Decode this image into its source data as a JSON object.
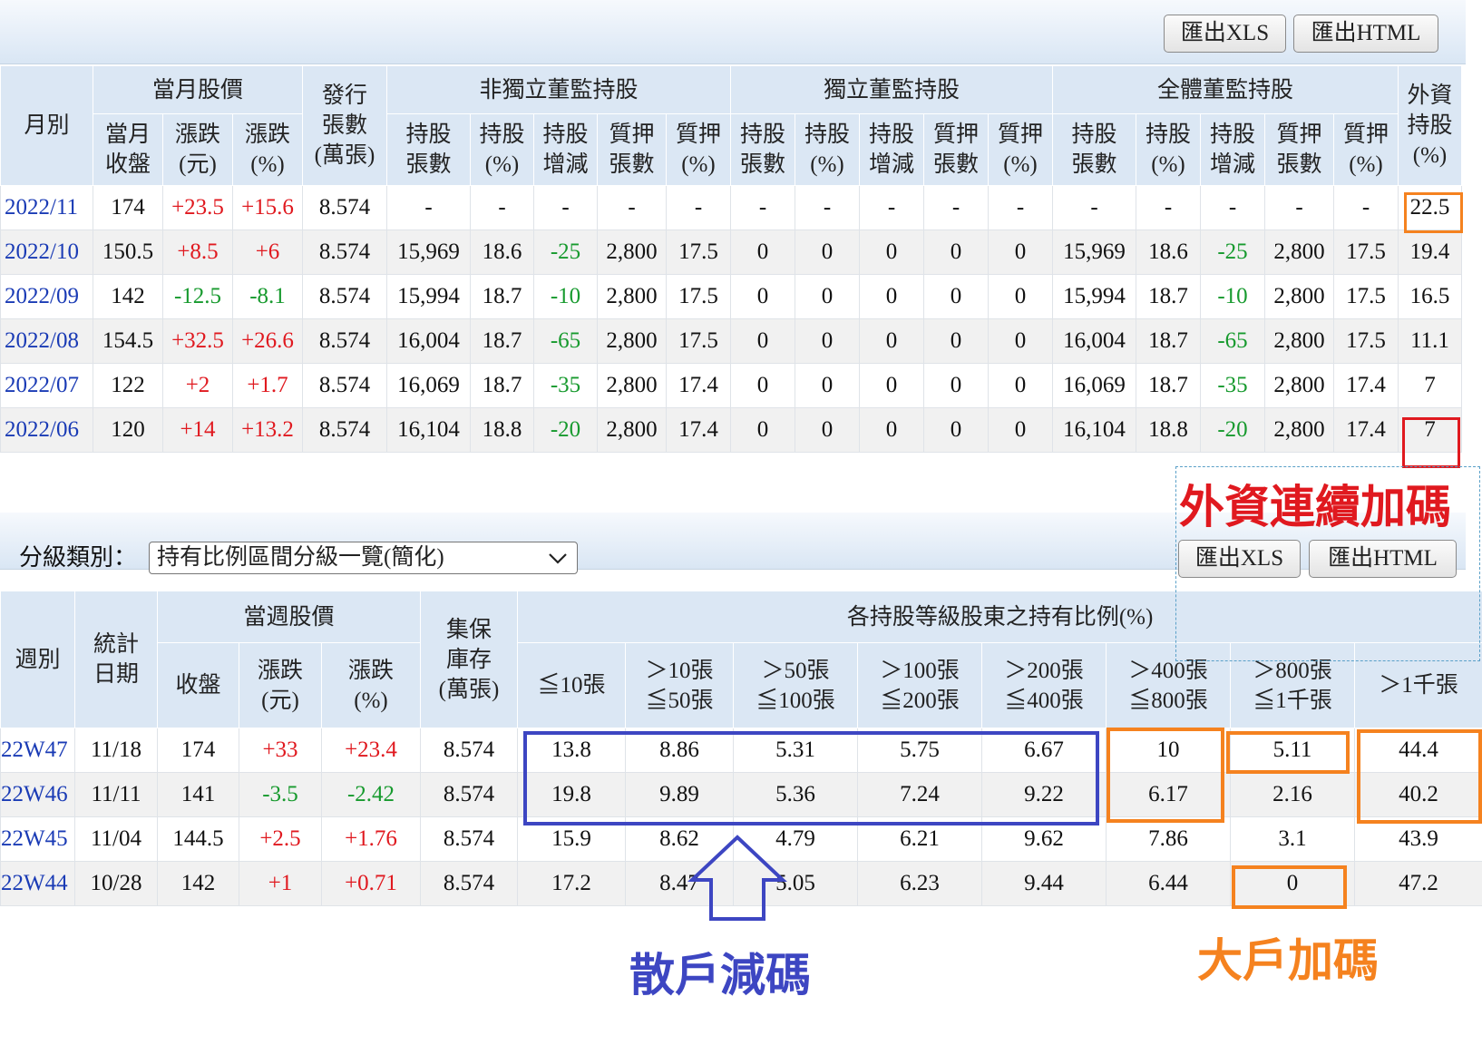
{
  "buttons": {
    "xls": "匯出XLS",
    "html": "匯出HTML"
  },
  "table1": {
    "month_col": "月別",
    "group_price": "當月股價",
    "issued": "發行\n張數\n(萬張)",
    "group_nonind": "非獨立董監持股",
    "group_ind": "獨立董監持股",
    "group_all": "全體董監持股",
    "foreign": "外資\n持股\n(%)",
    "price_cols": [
      "當月\n收盤",
      "漲跌\n(元)",
      "漲跌\n(%)"
    ],
    "hold_cols": [
      "持股\n張數",
      "持股\n(%)",
      "持股\n增減",
      "質押\n張數",
      "質押\n(%)"
    ],
    "rows": [
      [
        "2022/11",
        "174",
        "+23.5",
        "+15.6",
        "8.574",
        "-",
        "-",
        "-",
        "-",
        "-",
        "-",
        "-",
        "-",
        "-",
        "-",
        "-",
        "-",
        "-",
        "-",
        "-",
        "22.5"
      ],
      [
        "2022/10",
        "150.5",
        "+8.5",
        "+6",
        "8.574",
        "15,969",
        "18.6",
        "-25",
        "2,800",
        "17.5",
        "0",
        "0",
        "0",
        "0",
        "0",
        "15,969",
        "18.6",
        "-25",
        "2,800",
        "17.5",
        "19.4"
      ],
      [
        "2022/09",
        "142",
        "-12.5",
        "-8.1",
        "8.574",
        "15,994",
        "18.7",
        "-10",
        "2,800",
        "17.5",
        "0",
        "0",
        "0",
        "0",
        "0",
        "15,994",
        "18.7",
        "-10",
        "2,800",
        "17.5",
        "16.5"
      ],
      [
        "2022/08",
        "154.5",
        "+32.5",
        "+26.6",
        "8.574",
        "16,004",
        "18.7",
        "-65",
        "2,800",
        "17.5",
        "0",
        "0",
        "0",
        "0",
        "0",
        "16,004",
        "18.7",
        "-65",
        "2,800",
        "17.5",
        "11.1"
      ],
      [
        "2022/07",
        "122",
        "+2",
        "+1.7",
        "8.574",
        "16,069",
        "18.7",
        "-35",
        "2,800",
        "17.4",
        "0",
        "0",
        "0",
        "0",
        "0",
        "16,069",
        "18.7",
        "-35",
        "2,800",
        "17.4",
        "7"
      ],
      [
        "2022/06",
        "120",
        "+14",
        "+13.2",
        "8.574",
        "16,104",
        "18.8",
        "-20",
        "2,800",
        "17.4",
        "0",
        "0",
        "0",
        "0",
        "0",
        "16,104",
        "18.8",
        "-20",
        "2,800",
        "17.4",
        "7"
      ]
    ]
  },
  "filter": {
    "label": "分級類別：",
    "selected": "持有比例區間分級一覽(簡化)"
  },
  "table2": {
    "week_col": "週別",
    "date_col": "統計\n日期",
    "group_price": "當週股價",
    "price_cols": [
      "收盤",
      "漲跌\n(元)",
      "漲跌\n(%)"
    ],
    "stock": "集保\n庫存\n(萬張)",
    "group_levels": "各持股等級股東之持有比例(%)",
    "level_cols": [
      "≦10張",
      "＞10張\n≦50張",
      "＞50張\n≦100張",
      "＞100張\n≦200張",
      "＞200張\n≦400張",
      "＞400張\n≦800張",
      "＞800張\n≦1千張",
      "＞1千張"
    ],
    "rows": [
      [
        "22W47",
        "11/18",
        "174",
        "+33",
        "+23.4",
        "8.574",
        "13.8",
        "8.86",
        "5.31",
        "5.75",
        "6.67",
        "10",
        "5.11",
        "44.4"
      ],
      [
        "22W46",
        "11/11",
        "141",
        "-3.5",
        "-2.42",
        "8.574",
        "19.8",
        "9.89",
        "5.36",
        "7.24",
        "9.22",
        "6.17",
        "2.16",
        "40.2"
      ],
      [
        "22W45",
        "11/04",
        "144.5",
        "+2.5",
        "+1.76",
        "8.574",
        "15.9",
        "8.62",
        "4.79",
        "6.21",
        "9.62",
        "7.86",
        "3.1",
        "43.9"
      ],
      [
        "22W44",
        "10/28",
        "142",
        "+1",
        "+0.71",
        "8.574",
        "17.2",
        "8.47",
        "5.05",
        "6.23",
        "9.44",
        "6.44",
        "0",
        "47.2"
      ]
    ]
  },
  "annotations": {
    "foreign_text": "外資連續加碼",
    "retail_text": "散戶減碼",
    "big_text": "大戶加碼",
    "colors": {
      "red": "#e0191f",
      "orange": "#f5821f",
      "blue": "#3d46c2"
    }
  }
}
